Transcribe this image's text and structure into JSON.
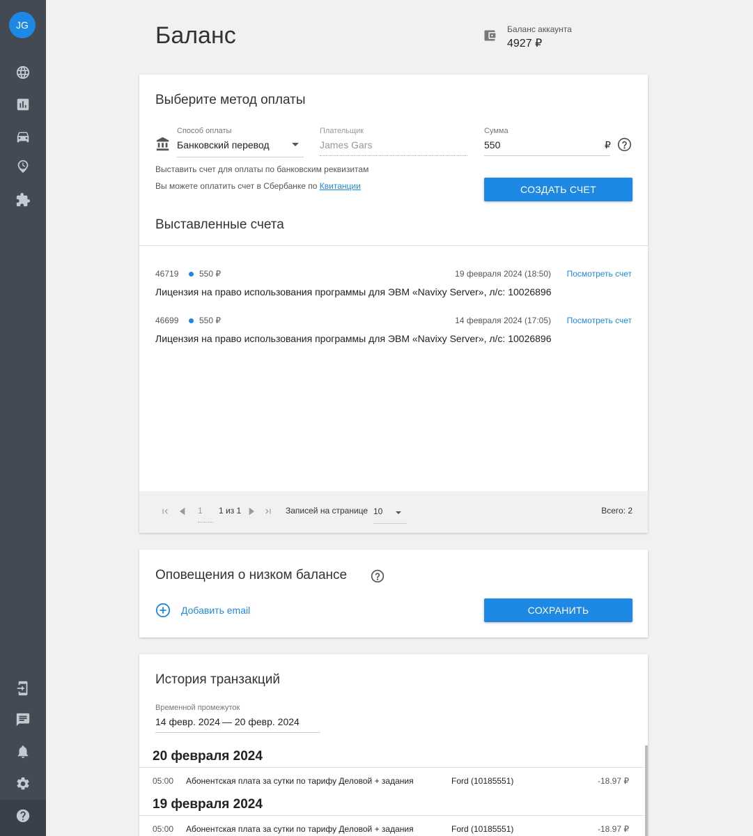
{
  "sidebar": {
    "avatar_initials": "JG",
    "icons": [
      "globe-icon",
      "chart-icon",
      "car-icon",
      "clock-pin-icon",
      "puzzle-icon",
      "device-add-icon",
      "chat-icon",
      "bell-icon",
      "gear-icon",
      "help-icon"
    ]
  },
  "header": {
    "title": "Баланс",
    "balance_label": "Баланс аккаунта",
    "balance_value": "4927 ₽"
  },
  "payment": {
    "title": "Выберите метод оплаты",
    "method_label": "Способ оплаты",
    "method_value": "Банковский перевод",
    "payer_label": "Плательщик",
    "payer_placeholder": "James Gars",
    "sum_label": "Сумма",
    "sum_value": "550",
    "currency": "₽",
    "helper1": "Выставить счет для оплаты по банковским реквизитам",
    "helper2_prefix": "Вы можете оплатить счет в Сбербанке по ",
    "helper2_link": "Квитанции",
    "create_button": "СОЗДАТЬ СЧЕТ"
  },
  "invoices": {
    "title": "Выставленные счета",
    "items": [
      {
        "number": "46719",
        "amount": "550 ₽",
        "date": "19 февраля 2024 (18:50)",
        "link": "Посмотреть счет",
        "description": "Лицензия на право использования программы для ЭВМ «Navixy Server», л/с: 10026896"
      },
      {
        "number": "46699",
        "amount": "550 ₽",
        "date": "14 февраля 2024 (17:05)",
        "link": "Посмотреть счет",
        "description": "Лицензия на право использования программы для ЭВМ «Navixy Server», л/с: 10026896"
      }
    ],
    "pager": {
      "page_input": "1",
      "page_of": "1 из 1",
      "per_page_label": "Записей на странице",
      "per_page_value": "10",
      "total": "Всего: 2"
    }
  },
  "notifications": {
    "title": "Оповещения о низком балансе",
    "add_email": "Добавить email",
    "save_button": "СОХРАНИТЬ"
  },
  "history": {
    "title": "История транзакций",
    "period_label": "Временной промежуток",
    "period_start": "14 февр. 2024",
    "period_end": "— 20 февр. 2024",
    "groups": [
      {
        "date": "20 февраля 2024",
        "rows": [
          {
            "time": "05:00",
            "description": "Абонентская плата за сутки по тарифу Деловой + задания",
            "object": "Ford (10185551)",
            "amount": "-18.97 ₽"
          }
        ]
      },
      {
        "date": "19 февраля 2024",
        "rows": [
          {
            "time": "05:00",
            "description": "Абонентская плата за сутки по тарифу Деловой + задания",
            "object": "Ford (10185551)",
            "amount": "-18.97 ₽"
          }
        ]
      }
    ]
  },
  "colors": {
    "accent": "#1e88e5",
    "sidebar": "#434a54"
  }
}
